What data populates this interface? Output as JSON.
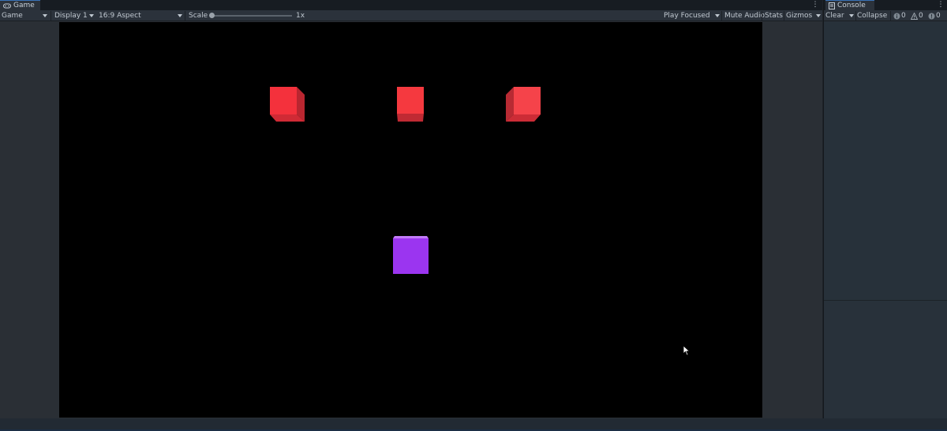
{
  "game": {
    "tab_label": "Game",
    "tab_icon": "gamepad-icon",
    "toolbar": {
      "mode": "Game",
      "display": "Display 1",
      "aspect": "16:9 Aspect",
      "scale_label": "Scale",
      "scale_value": "1x",
      "play_mode": "Play Focused",
      "mute_audio": "Mute Audio",
      "stats": "Stats",
      "gizmos": "Gizmos"
    },
    "scene": {
      "background": "#000000",
      "enemy_color": "#ff3b44",
      "player_color": "#9b35f0"
    }
  },
  "console": {
    "tab_label": "Console",
    "tab_icon": "console-icon",
    "toolbar": {
      "clear": "Clear",
      "collapse": "Collapse",
      "log_count": "0",
      "warning_count": "0",
      "error_count": "0"
    }
  }
}
